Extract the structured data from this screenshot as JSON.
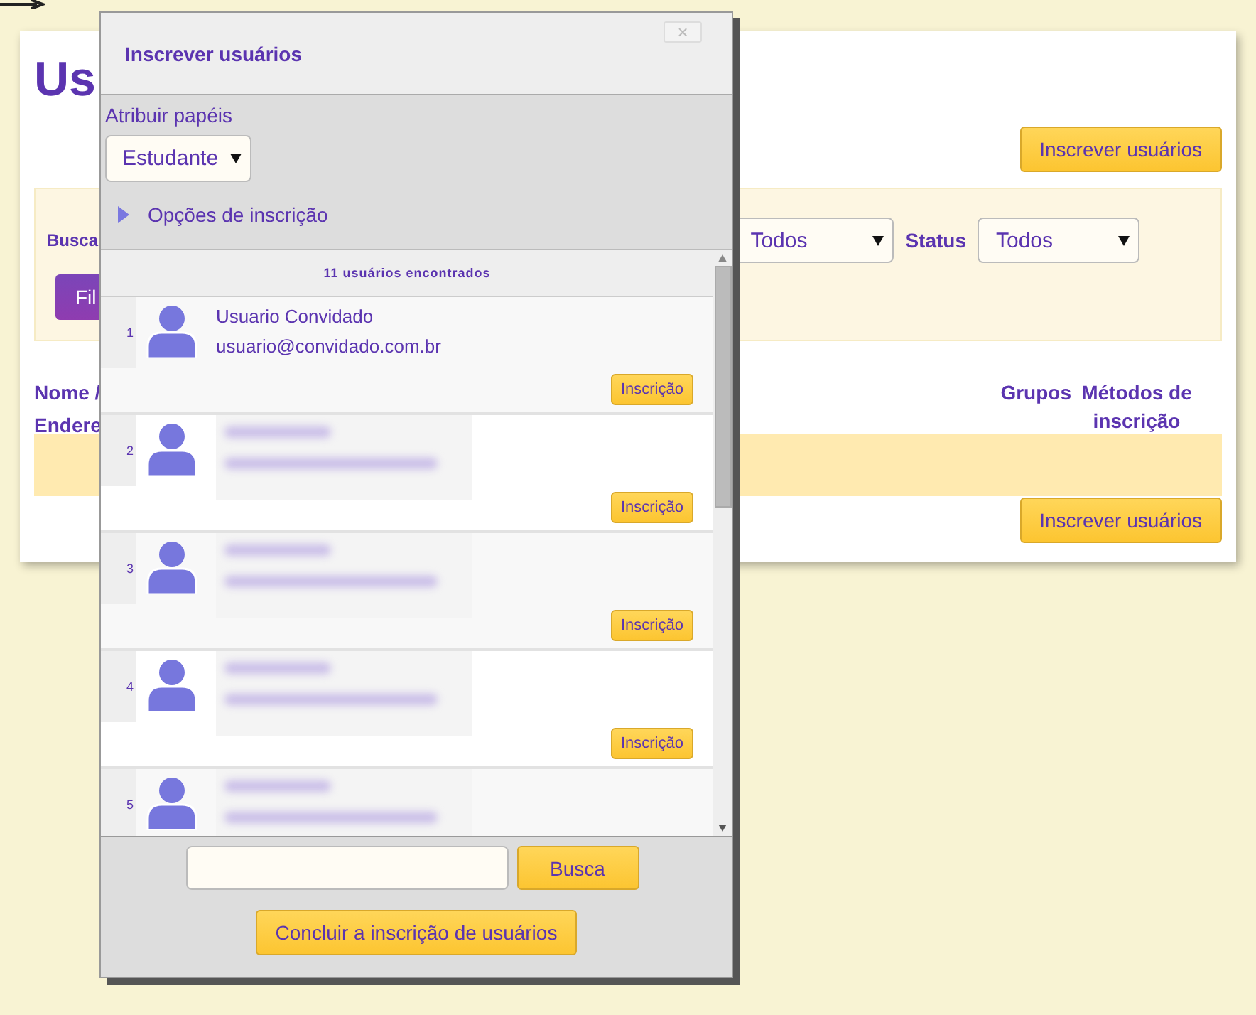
{
  "page": {
    "title": "Us",
    "top_button": "Inscrever usuários",
    "filter": {
      "search_label": "Busca",
      "filter_button": "Fil",
      "select_1": "Todos",
      "status_label": "Status",
      "select_2": "Todos"
    },
    "columns": {
      "column_1": [
        "Nome /",
        "Endere"
      ],
      "groups": "Grupos",
      "methods": "Métodos de inscrição"
    },
    "bottom_button": "Inscrever usuários"
  },
  "dialog": {
    "title": "Inscrever usuários",
    "close": "×",
    "close_disabled": true,
    "assign_roles_label": "Atribuir papéis",
    "role": "Estudante",
    "options_label": "Opções de inscrição",
    "options_expanded": false,
    "found": "11 usuários encontrados",
    "users": [
      {
        "number": "1",
        "blurred": false,
        "name": "Usuario Convidado",
        "email": "usuario@convidado.com.br",
        "button": "Inscrição"
      },
      {
        "number": "2",
        "blurred": true,
        "button": "Inscrição"
      },
      {
        "number": "3",
        "blurred": true,
        "button": "Inscrição"
      },
      {
        "number": "4",
        "blurred": true,
        "button": "Inscrição"
      },
      {
        "number": "5",
        "blurred": true
      }
    ],
    "search_button": "Busca",
    "finish_button": "Concluir a inscrição de usuários"
  }
}
